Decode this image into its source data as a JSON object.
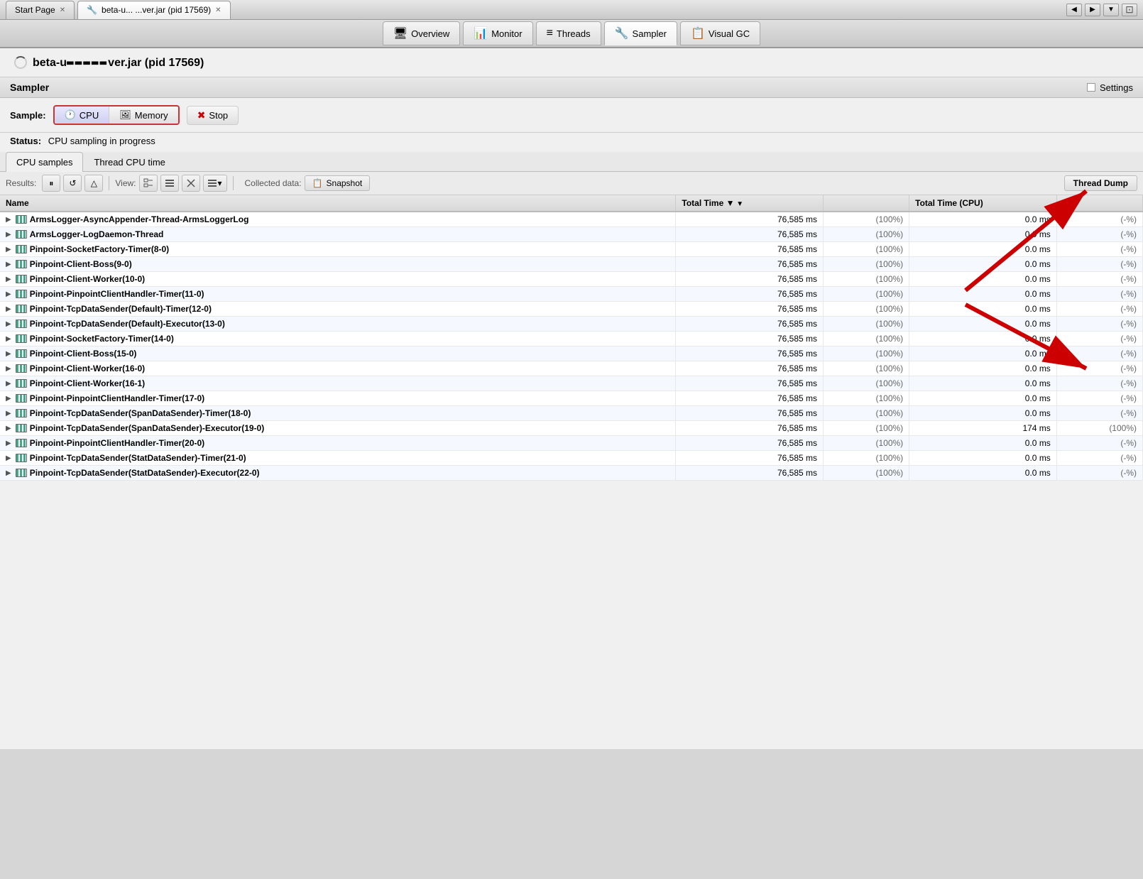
{
  "titleBar": {
    "tabs": [
      {
        "id": "start",
        "label": "Start Page",
        "active": false
      },
      {
        "id": "jmx",
        "label": "beta-u... ...ver.jar (pid 17569)",
        "active": true
      }
    ],
    "arrowLeft": "◀",
    "arrowRight": "▶",
    "arrowMenu": "▼"
  },
  "navBar": {
    "tabs": [
      {
        "id": "overview",
        "label": "Overview",
        "icon": "🖥",
        "active": false
      },
      {
        "id": "monitor",
        "label": "Monitor",
        "icon": "📊",
        "active": false
      },
      {
        "id": "threads",
        "label": "Threads",
        "icon": "≡",
        "active": false
      },
      {
        "id": "sampler",
        "label": "Sampler",
        "icon": "🔧",
        "active": true
      },
      {
        "id": "visualgc",
        "label": "Visual GC",
        "icon": "📋",
        "active": false
      }
    ]
  },
  "appTitle": "beta-u... r...l...l...ier.jar (pid 17569)",
  "panel": {
    "title": "Sampler",
    "settingsLabel": "Settings"
  },
  "sample": {
    "label": "Sample:",
    "cpuLabel": "CPU",
    "memoryLabel": "Memory",
    "stopLabel": "Stop",
    "statusLabel": "Status:",
    "statusValue": "CPU sampling in progress"
  },
  "tabs": {
    "cpuSamples": "CPU samples",
    "threadCpuTime": "Thread CPU time"
  },
  "toolbar": {
    "collecteddataLabel": "Collected data:",
    "snapshotLabel": "Snapshot",
    "threadDumpLabel": "Thread Dump"
  },
  "table": {
    "columns": {
      "name": "Name",
      "totalTime": "Total Time",
      "totalTimeCPU": "Total Time (CPU)"
    },
    "rows": [
      {
        "name": "ArmsLogger-AsyncAppender-Thread-ArmsLoggerLog",
        "totalTime": "76,585 ms",
        "totalTimePct": "(100%)",
        "cpuTime": "0.0 ms",
        "cpuPct": "(-%)"
      },
      {
        "name": "ArmsLogger-LogDaemon-Thread",
        "totalTime": "76,585 ms",
        "totalTimePct": "(100%)",
        "cpuTime": "0.0 ms",
        "cpuPct": "(-%)"
      },
      {
        "name": "Pinpoint-SocketFactory-Timer(8-0)",
        "totalTime": "76,585 ms",
        "totalTimePct": "(100%)",
        "cpuTime": "0.0 ms",
        "cpuPct": "(-%)"
      },
      {
        "name": "Pinpoint-Client-Boss(9-0)",
        "totalTime": "76,585 ms",
        "totalTimePct": "(100%)",
        "cpuTime": "0.0 ms",
        "cpuPct": "(-%)"
      },
      {
        "name": "Pinpoint-Client-Worker(10-0)",
        "totalTime": "76,585 ms",
        "totalTimePct": "(100%)",
        "cpuTime": "0.0 ms",
        "cpuPct": "(-%)"
      },
      {
        "name": "Pinpoint-PinpointClientHandler-Timer(11-0)",
        "totalTime": "76,585 ms",
        "totalTimePct": "(100%)",
        "cpuTime": "0.0 ms",
        "cpuPct": "(-%)"
      },
      {
        "name": "Pinpoint-TcpDataSender(Default)-Timer(12-0)",
        "totalTime": "76,585 ms",
        "totalTimePct": "(100%)",
        "cpuTime": "0.0 ms",
        "cpuPct": "(-%)"
      },
      {
        "name": "Pinpoint-TcpDataSender(Default)-Executor(13-0)",
        "totalTime": "76,585 ms",
        "totalTimePct": "(100%)",
        "cpuTime": "0.0 ms",
        "cpuPct": "(-%)"
      },
      {
        "name": "Pinpoint-SocketFactory-Timer(14-0)",
        "totalTime": "76,585 ms",
        "totalTimePct": "(100%)",
        "cpuTime": "0.0 ms",
        "cpuPct": "(-%)"
      },
      {
        "name": "Pinpoint-Client-Boss(15-0)",
        "totalTime": "76,585 ms",
        "totalTimePct": "(100%)",
        "cpuTime": "0.0 ms",
        "cpuPct": "(-%)"
      },
      {
        "name": "Pinpoint-Client-Worker(16-0)",
        "totalTime": "76,585 ms",
        "totalTimePct": "(100%)",
        "cpuTime": "0.0 ms",
        "cpuPct": "(-%)"
      },
      {
        "name": "Pinpoint-Client-Worker(16-1)",
        "totalTime": "76,585 ms",
        "totalTimePct": "(100%)",
        "cpuTime": "0.0 ms",
        "cpuPct": "(-%)"
      },
      {
        "name": "Pinpoint-PinpointClientHandler-Timer(17-0)",
        "totalTime": "76,585 ms",
        "totalTimePct": "(100%)",
        "cpuTime": "0.0 ms",
        "cpuPct": "(-%)"
      },
      {
        "name": "Pinpoint-TcpDataSender(SpanDataSender)-Timer(18-0)",
        "totalTime": "76,585 ms",
        "totalTimePct": "(100%)",
        "cpuTime": "0.0 ms",
        "cpuPct": "(-%)"
      },
      {
        "name": "Pinpoint-TcpDataSender(SpanDataSender)-Executor(19-0)",
        "totalTime": "76,585 ms",
        "totalTimePct": "(100%)",
        "cpuTime": "174 ms",
        "cpuPct": "(100%)"
      },
      {
        "name": "Pinpoint-PinpointClientHandler-Timer(20-0)",
        "totalTime": "76,585 ms",
        "totalTimePct": "(100%)",
        "cpuTime": "0.0 ms",
        "cpuPct": "(-%)"
      },
      {
        "name": "Pinpoint-TcpDataSender(StatDataSender)-Timer(21-0)",
        "totalTime": "76,585 ms",
        "totalTimePct": "(100%)",
        "cpuTime": "0.0 ms",
        "cpuPct": "(-%)"
      },
      {
        "name": "Pinpoint-TcpDataSender(StatDataSender)-Executor(22-0)",
        "totalTime": "76,585 ms",
        "totalTimePct": "(100%)",
        "cpuTime": "0.0 ms",
        "cpuPct": "(-%)"
      }
    ]
  }
}
